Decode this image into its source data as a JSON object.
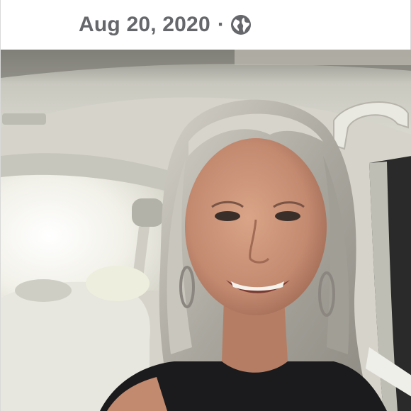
{
  "post": {
    "date": "Aug 20, 2020",
    "separator": "·",
    "privacy_icon": "globe-icon"
  },
  "photo": {
    "subject": "selfie-in-car",
    "colors": {
      "roof": "#cfcfc6",
      "hair": "#b8b5ad",
      "skin": "#c8937a",
      "shirt": "#1b1b1d",
      "window": "#f4f4ee"
    }
  }
}
